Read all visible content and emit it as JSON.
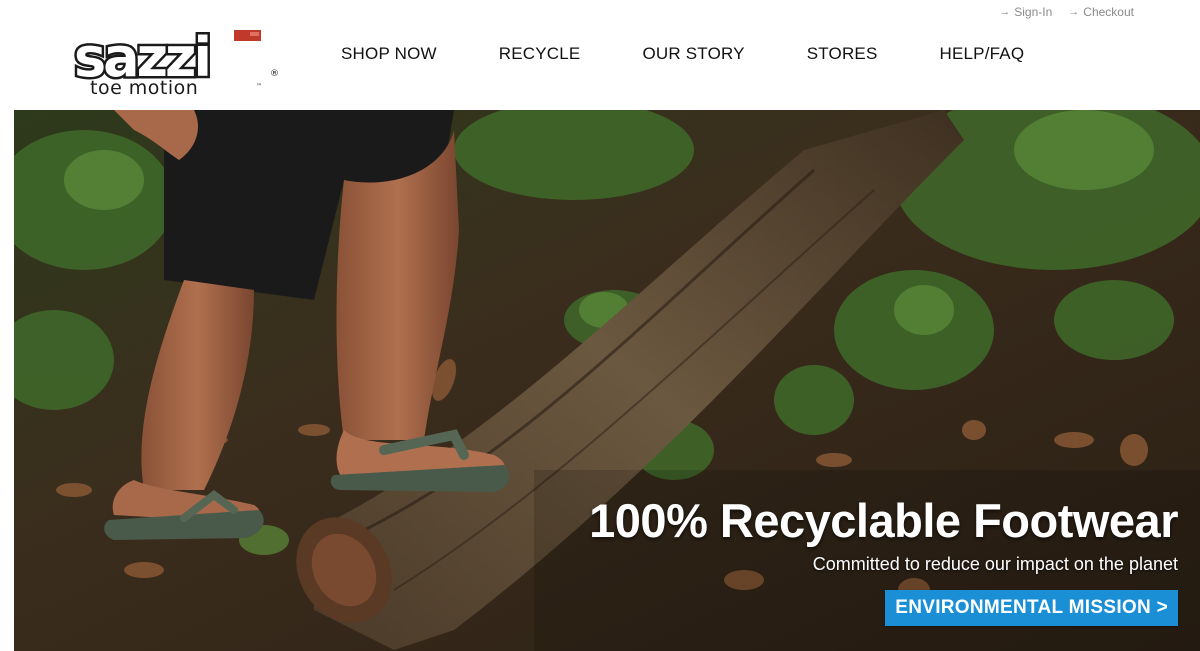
{
  "header": {
    "utility": {
      "sign_in": "Sign-In",
      "checkout": "Checkout",
      "arrow_icon": "arrow-right-icon"
    },
    "logo": {
      "wordmark": "sazzi",
      "tagline": "toe motion",
      "trademark": "®",
      "tm": "™"
    },
    "nav": [
      {
        "label": "SHOP NOW"
      },
      {
        "label": "RECYCLE"
      },
      {
        "label": "OUR STORY"
      },
      {
        "label": "STORES"
      },
      {
        "label": "HELP/FAQ"
      }
    ]
  },
  "hero": {
    "title": "100% Recyclable Footwear",
    "subtitle": "Committed to reduce our impact on the planet",
    "cta": "ENVIRONMENTAL MISSION >"
  },
  "colors": {
    "cta_background": "#1a8fd6",
    "logo_accent": "#c0392b",
    "nav_text": "#111111"
  }
}
